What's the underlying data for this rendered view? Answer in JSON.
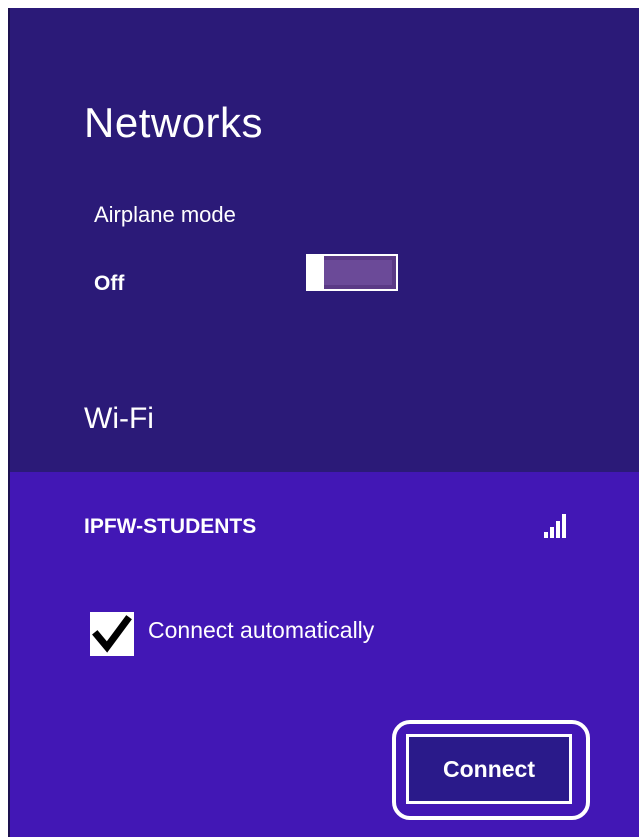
{
  "panel": {
    "title": "Networks"
  },
  "airplane_mode": {
    "label": "Airplane mode",
    "value": "Off",
    "enabled": false
  },
  "wifi": {
    "heading": "Wi-Fi",
    "network": {
      "name": "IPFW-STUDENTS",
      "signal_icon": "wifi-signal-bars-icon",
      "signal_bars": 4,
      "connect_automatically": {
        "label": "Connect automatically",
        "checked": true
      },
      "connect_button_label": "Connect"
    }
  },
  "colors": {
    "panel_bg": "#2b1a78",
    "selected_network_bg": "#4217b5",
    "text": "#ffffff"
  }
}
